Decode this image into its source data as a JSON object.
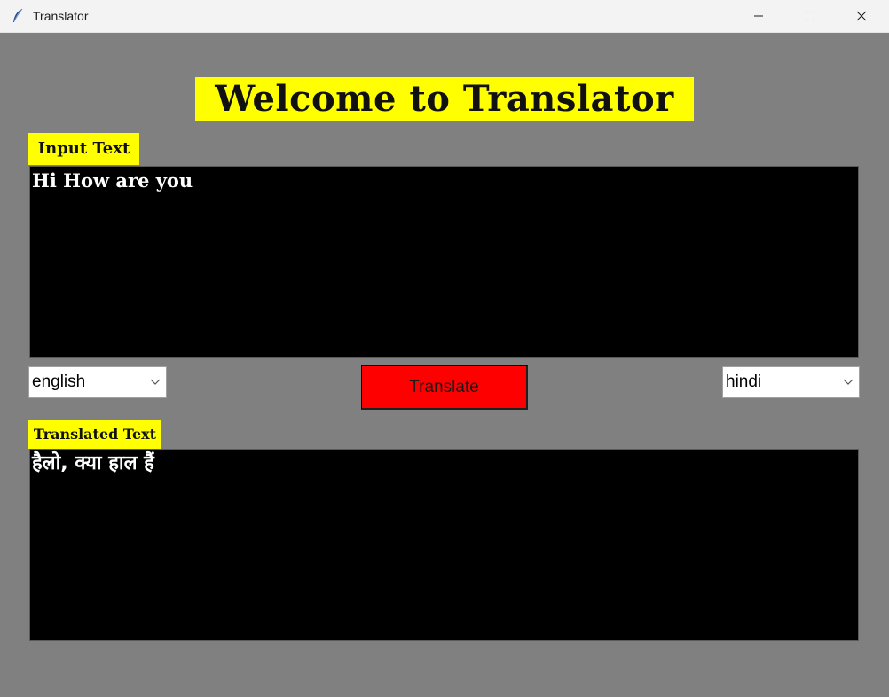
{
  "window": {
    "title": "Translator",
    "controls": {
      "minimize": "minimize-icon",
      "maximize": "maximize-icon",
      "close": "close-icon"
    }
  },
  "heading": "Welcome to Translator",
  "input": {
    "label": "Input Text",
    "value": "Hi How are you"
  },
  "controls": {
    "source_language": "english",
    "target_language": "hindi",
    "translate_label": "Translate"
  },
  "output": {
    "label": "Translated Text",
    "value": "हैलो, क्या हाल हैं"
  },
  "colors": {
    "background": "#808080",
    "label_bg": "#ffff00",
    "textbox_bg": "#000000",
    "textbox_text": "#ffffff",
    "button_bg": "#ff0000"
  }
}
